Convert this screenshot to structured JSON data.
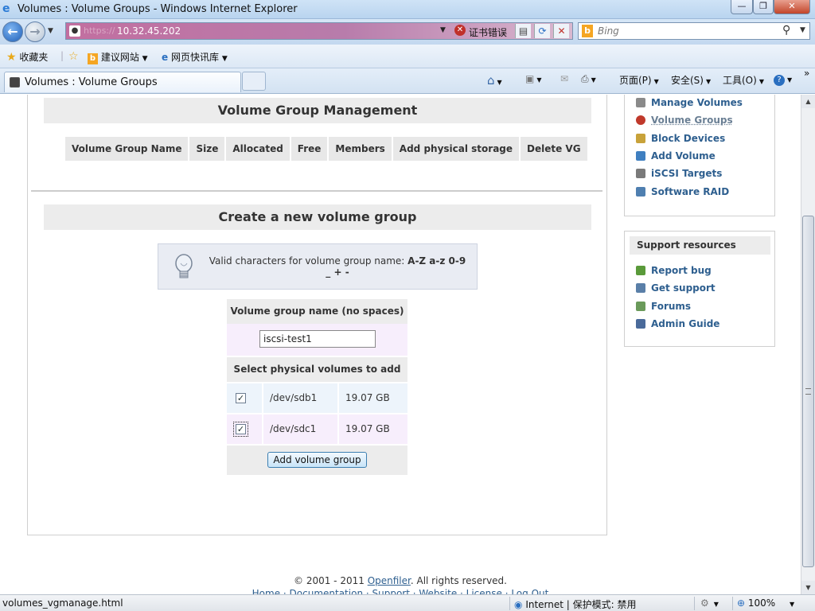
{
  "window": {
    "title": "Volumes : Volume Groups - Windows Internet Explorer",
    "min_glyph": "—",
    "max_glyph": "❐",
    "close_glyph": "✕"
  },
  "address_bar": {
    "protocol": "https://",
    "host": "10.32.45.202",
    "cert_error": "证书错误",
    "search_placeholder": "Bing"
  },
  "favorites_bar": {
    "favorites": "收藏夹",
    "suggested_sites": "建议网站",
    "web_slice_gallery": "网页快讯库"
  },
  "tab": {
    "title": "Volumes : Volume Groups"
  },
  "command_bar": {
    "page": "页面(P)",
    "safety": "安全(S)",
    "tools": "工具(O)",
    "more": "»"
  },
  "vg_management": {
    "heading": "Volume Group Management",
    "columns": [
      "Volume Group Name",
      "Size",
      "Allocated",
      "Free",
      "Members",
      "Add physical storage",
      "Delete VG"
    ]
  },
  "create_vg": {
    "heading": "Create a new volume group",
    "tip_prefix": "Valid characters for volume group name: ",
    "tip_chars": "A-Z a-z 0-9 _ + -",
    "name_label": "Volume group name (no spaces)",
    "name_value": "iscsi-test1",
    "pv_label": "Select physical volumes to add",
    "physical_volumes": [
      {
        "device": "/dev/sdb1",
        "size": "19.07 GB",
        "checked": true
      },
      {
        "device": "/dev/sdc1",
        "size": "19.07 GB",
        "checked": true
      }
    ],
    "submit_label": "Add volume group"
  },
  "sidebar": {
    "nav_items": [
      {
        "label": "Manage Volumes",
        "icon": "disk-icon",
        "color": "#8a8a8a"
      },
      {
        "label": "Volume Groups",
        "icon": "volume-groups-icon",
        "color": "#c0392b"
      },
      {
        "label": "Block Devices",
        "icon": "block-devices-icon",
        "color": "#c8a23a"
      },
      {
        "label": "Add Volume",
        "icon": "add-volume-icon",
        "color": "#3f7fc0"
      },
      {
        "label": "iSCSI Targets",
        "icon": "iscsi-icon",
        "color": "#7a7a7a"
      },
      {
        "label": "Software RAID",
        "icon": "raid-icon",
        "color": "#4f7fb0"
      }
    ],
    "support_heading": "Support resources",
    "support_items": [
      {
        "label": "Report bug",
        "icon": "bug-icon",
        "color": "#5a9a3a"
      },
      {
        "label": "Get support",
        "icon": "support-icon",
        "color": "#5a7fa8"
      },
      {
        "label": "Forums",
        "icon": "forums-icon",
        "color": "#6a9a5a"
      },
      {
        "label": "Admin Guide",
        "icon": "guide-icon",
        "color": "#4a6a9a"
      }
    ]
  },
  "footer": {
    "copyright_prefix": "© 2001 - 2011 ",
    "brand": "Openfiler",
    "copyright_suffix": ". All rights reserved.",
    "links": "Home · Documentation · Support · Website · License · Log Out"
  },
  "status_bar": {
    "url": "volumes_vgmanage.html",
    "zone": "Internet | 保护模式: 禁用",
    "zoom": "100%"
  }
}
